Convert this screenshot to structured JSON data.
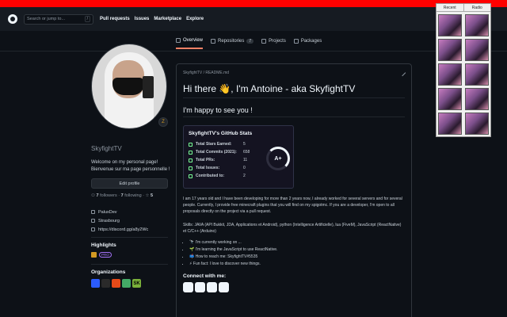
{
  "header": {
    "search_placeholder": "Search or jump to...",
    "search_shortcut": "/",
    "nav": [
      "Pull requests",
      "Issues",
      "Marketplace",
      "Explore"
    ]
  },
  "tabs": [
    {
      "label": "Overview",
      "icon": "book-icon",
      "active": true
    },
    {
      "label": "Repositories",
      "icon": "repo-icon",
      "count": "7"
    },
    {
      "label": "Projects",
      "icon": "project-icon"
    },
    {
      "label": "Packages",
      "icon": "package-icon"
    }
  ],
  "profile": {
    "username": "SkyfightTV",
    "status_emoji": "Z",
    "bio_line1": "Welcome on my personal page!",
    "bio_line2": "Bienvenue sur ma page personnelle !",
    "edit_label": "Edit profile",
    "followers": "7",
    "followers_label": "followers",
    "following": "7",
    "following_label": "following",
    "stars": "5",
    "company": "PaluxDev",
    "location": "Strasbourg",
    "link": "https://discord.gg/a8y2Wc",
    "highlights_title": "Highlights",
    "pro_badge": "PRO",
    "organizations_title": "Organizations",
    "org_colors": [
      "#2b5cff",
      "#2a2a2a",
      "#e64a19",
      "#44aa66",
      "#7ab03a"
    ],
    "org_last_label": "SK"
  },
  "readme": {
    "path": "SkyfightTV / README.md",
    "h1": "Hi there 👋, I'm Antoine - aka SkyfightTV",
    "h2": "I'm happy to see you !",
    "stats": {
      "title": "SkyfightTV's GitHub Stats",
      "rows": [
        {
          "label": "Total Stars Earned:",
          "value": "5"
        },
        {
          "label": "Total Commits (2021):",
          "value": "658"
        },
        {
          "label": "Total PRs:",
          "value": "11"
        },
        {
          "label": "Total Issues:",
          "value": "0"
        },
        {
          "label": "Contributed to:",
          "value": "2"
        }
      ],
      "grade": "A+"
    },
    "para1": "I am 17 years old and I have been developing for more than 2 years now, I already worked for several servers and for several people. Currently, I provide free minecraft plugins that you will find on my spigotmc. If you are a developer, I'm open to all proposals directly on the project via a pull request.",
    "skills": "Skills: JAVA (API Bukkit, JDA, Applications et Android), python (Intelligence Artificielle), lua (FiveM), JavaScript (ReactNative) et C/C++ (Arduino)",
    "bullets": [
      "🔭 I'm currently working on ...",
      "🌱 I'm learning the JavaScript to use ReactNative.",
      "📫 How to reach me: SkyfightTV#5535",
      "⚡ Fun fact: I love to discover new things."
    ],
    "connect": "Connect with me:"
  },
  "popup": {
    "tab_recent": "Recent",
    "tab_radio": "Radio"
  }
}
